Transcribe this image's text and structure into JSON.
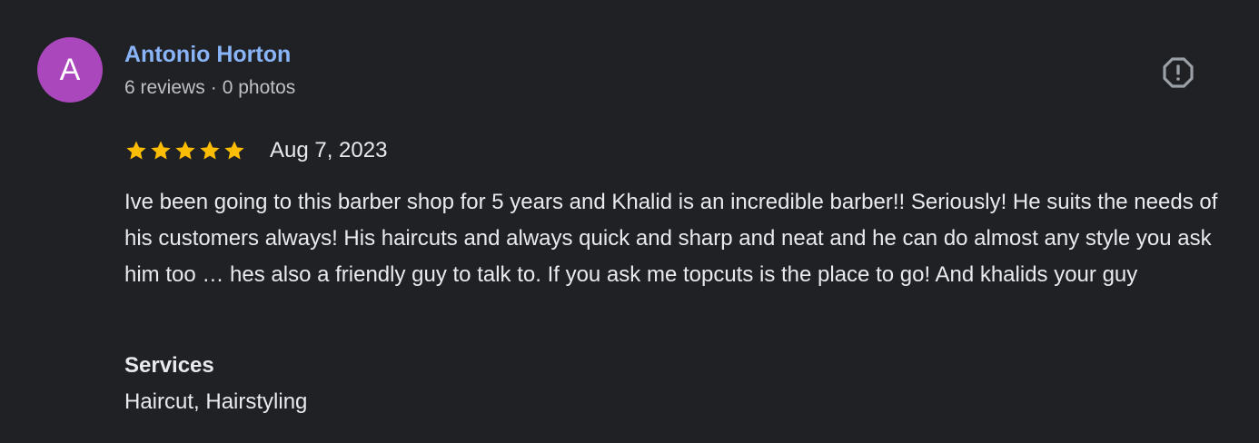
{
  "reviewer": {
    "initial": "A",
    "name": "Antonio Horton",
    "reviews_count": "6 reviews",
    "separator": "·",
    "photos_count": "0 photos",
    "avatar_color": "#ab47bc"
  },
  "report_icon": "report-flag-icon",
  "rating": {
    "stars": 5,
    "max_stars": 5,
    "star_color": "#fbbc04",
    "date": "Aug 7, 2023"
  },
  "review_text": "Ive been going to this barber shop for 5 years and Khalid is an incredible barber!! Seriously! He suits the needs of his customers always! His haircuts and always quick and sharp and neat and he can do almost any style you ask him too … hes also a friendly guy to talk to. If you ask me topcuts is the place to go! And khalids your guy",
  "services": {
    "title": "Services",
    "value": "Haircut, Hairstyling"
  },
  "colors": {
    "background": "#202124",
    "name_link": "#8ab4f8",
    "primary_text": "#e8eaed",
    "secondary_text": "#bdc1c6",
    "icon": "#9aa0a6"
  }
}
